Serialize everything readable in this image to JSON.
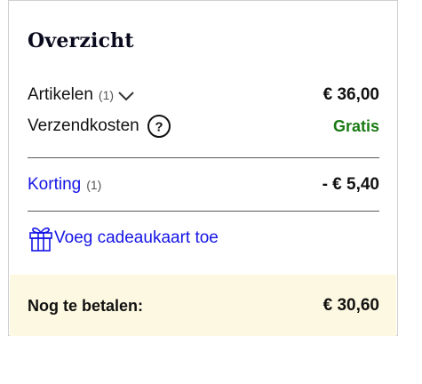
{
  "summary": {
    "title": "Overzicht",
    "items": {
      "label": "Artikelen",
      "count": "(1)",
      "amount": "€ 36,00"
    },
    "shipping": {
      "label": "Verzendkosten",
      "value": "Gratis"
    },
    "discount": {
      "label": "Korting",
      "count": "(1)",
      "amount": "- € 5,40"
    },
    "gift_card": {
      "label": "Voeg cadeaukaart toe"
    },
    "total": {
      "label": "Nog te betalen:",
      "amount": "€ 30,60"
    }
  },
  "colors": {
    "link": "#1414e6",
    "free": "#1a7a14",
    "total_background": "#fdf8e1"
  },
  "icons": [
    "chevron-down-icon",
    "help-circle-icon",
    "gift-icon"
  ]
}
